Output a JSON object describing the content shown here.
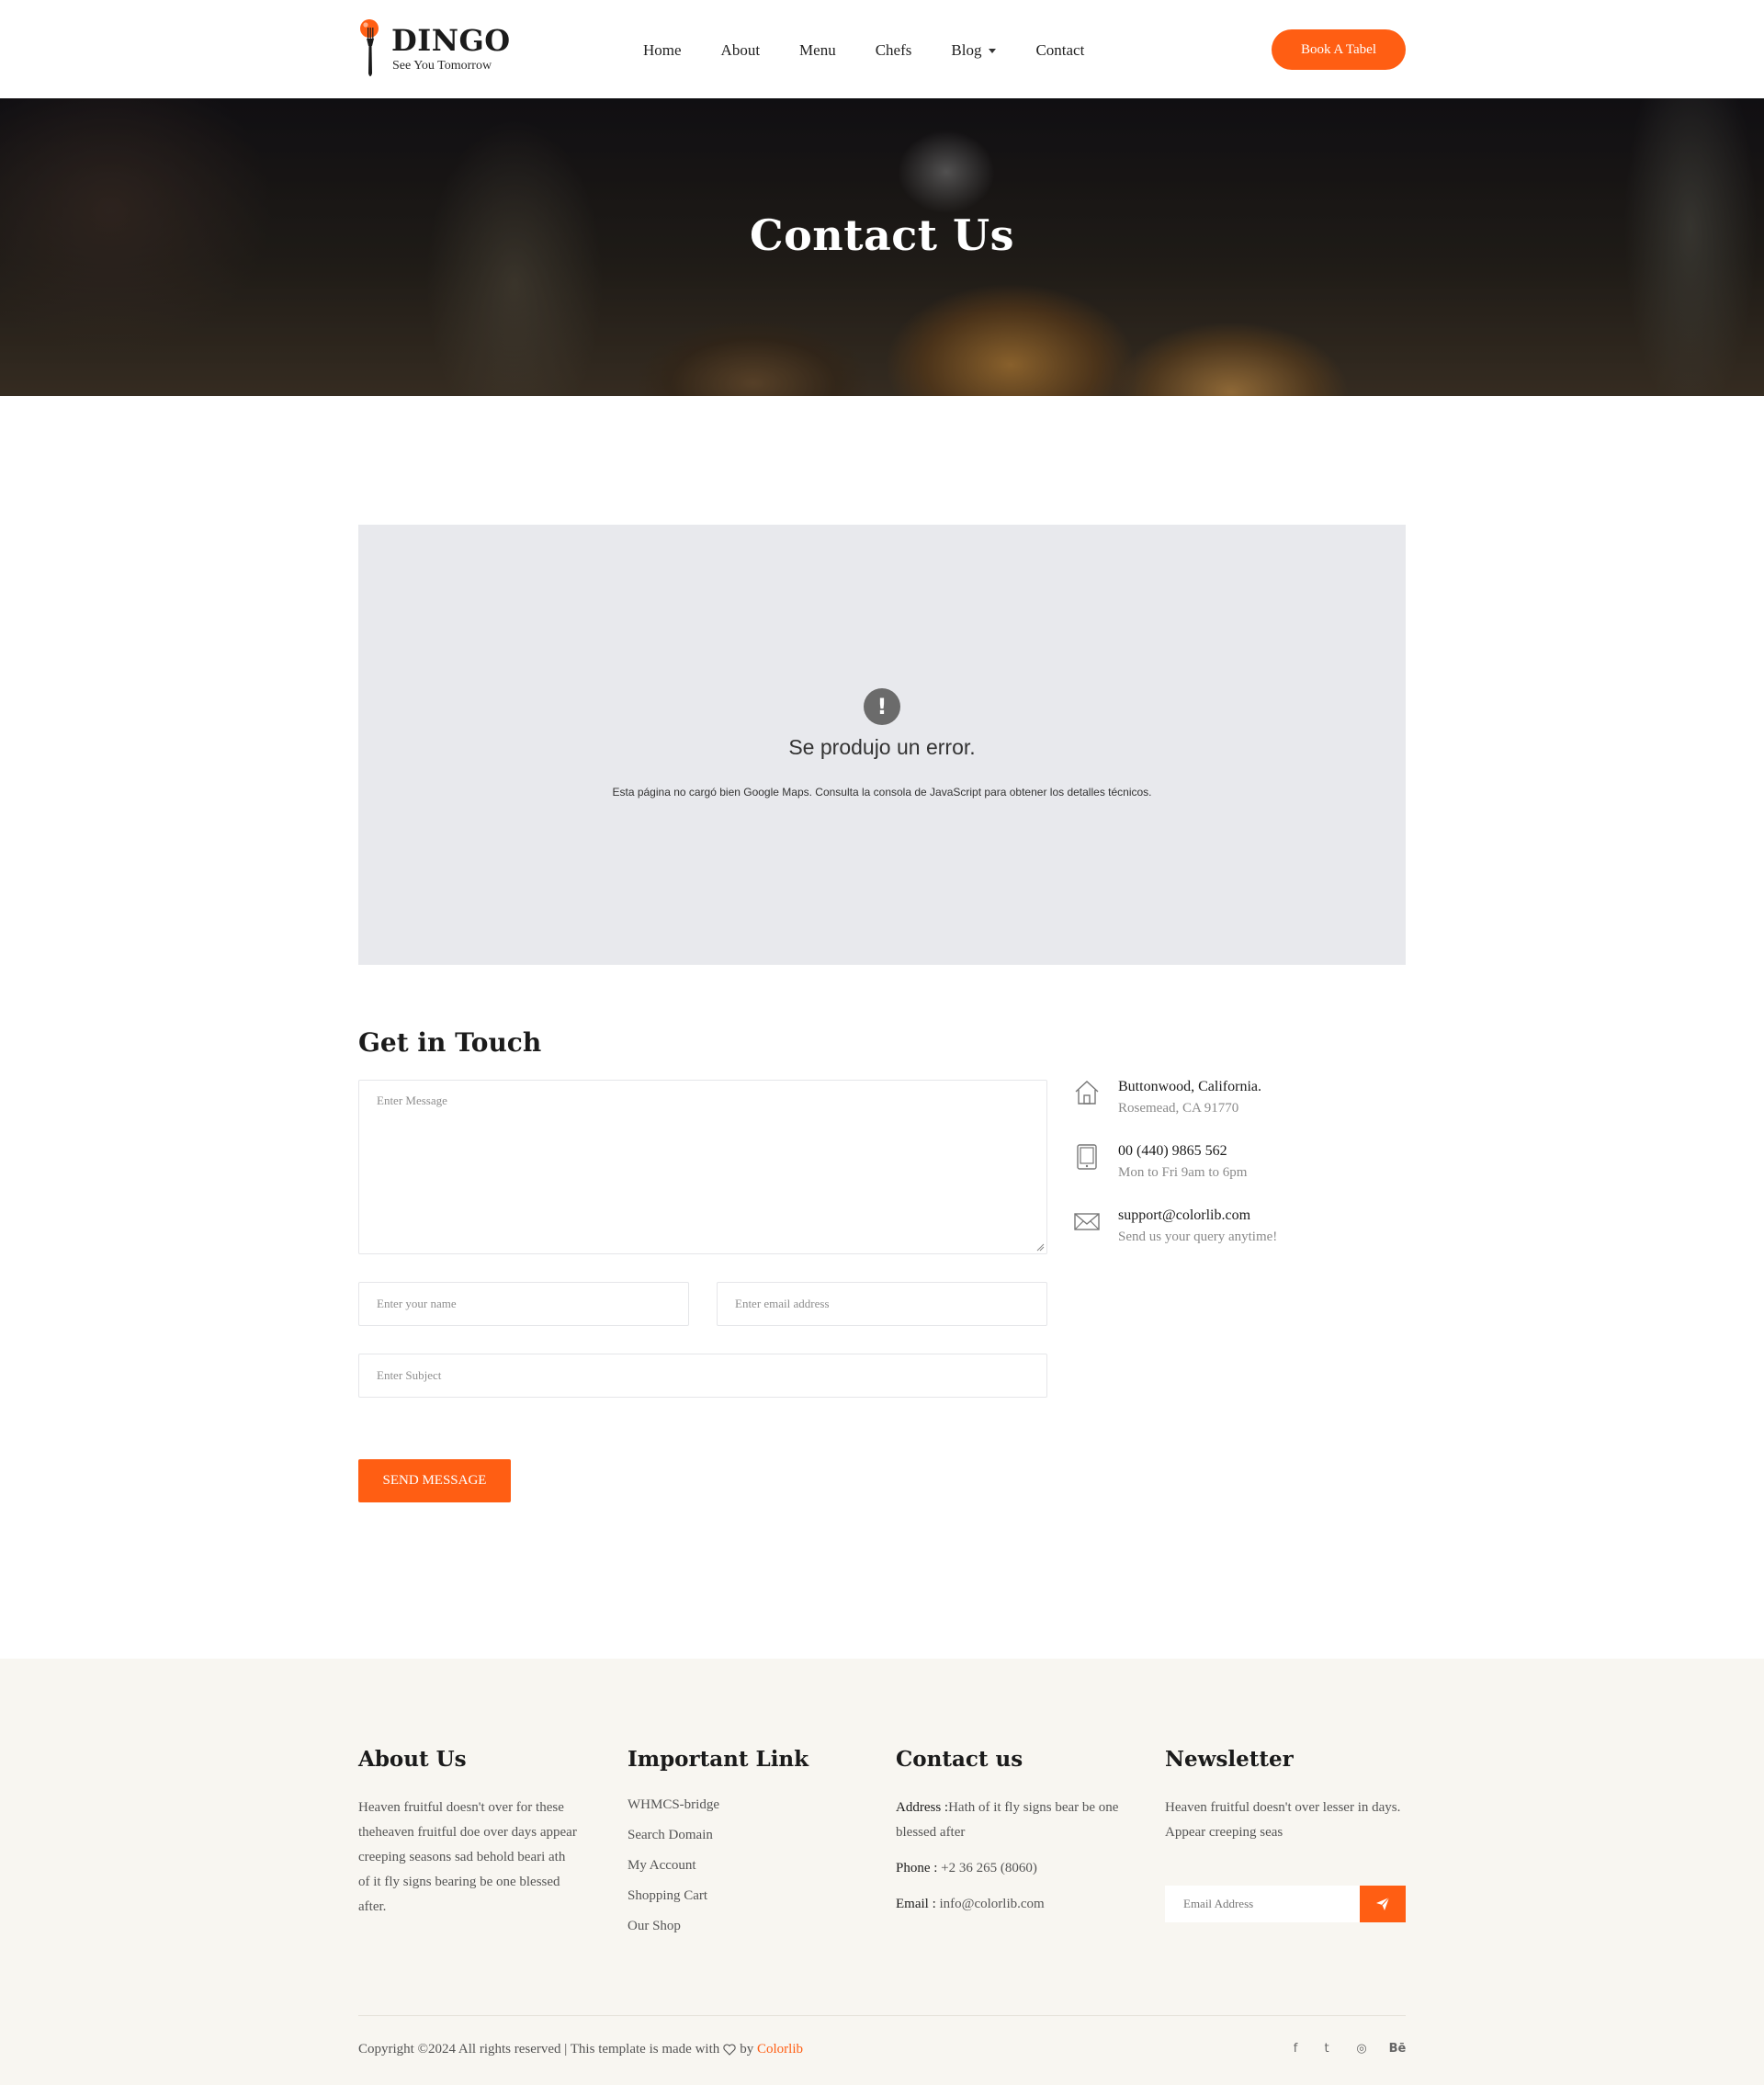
{
  "header": {
    "logo_title": "DINGO",
    "logo_tagline": "See You Tomorrow",
    "nav": [
      {
        "label": "Home"
      },
      {
        "label": "About"
      },
      {
        "label": "Menu"
      },
      {
        "label": "Chefs"
      },
      {
        "label": "Blog",
        "has_dropdown": true
      },
      {
        "label": "Contact"
      }
    ],
    "cta_label": "Book A Tabel"
  },
  "banner": {
    "title": "Contact Us"
  },
  "map": {
    "error_title": "Se produjo un error.",
    "error_text": "Esta página no cargó bien Google Maps. Consulta la consola de JavaScript para obtener los detalles técnicos."
  },
  "contact": {
    "title": "Get in Touch",
    "message_placeholder": "Enter Message",
    "name_placeholder": "Enter your name",
    "email_placeholder": "Enter email address",
    "subject_placeholder": "Enter Subject",
    "send_label": "SEND MESSAGE",
    "info": [
      {
        "icon": "home-icon",
        "main": "Buttonwood, California.",
        "sub": "Rosemead, CA 91770"
      },
      {
        "icon": "tablet-icon",
        "main": "00 (440) 9865 562",
        "sub": "Mon to Fri 9am to 6pm"
      },
      {
        "icon": "email-icon",
        "main": "support@colorlib.com",
        "sub": "Send us your query anytime!"
      }
    ]
  },
  "footer": {
    "about": {
      "title": "About Us",
      "text": "Heaven fruitful doesn't over for these theheaven fruitful doe over days appear creeping seasons sad behold beari ath of it fly signs bearing be one blessed after."
    },
    "links": {
      "title": "Important Link",
      "items": [
        "WHMCS-bridge",
        "Search Domain",
        "My Account",
        "Shopping Cart",
        "Our Shop"
      ]
    },
    "contact": {
      "title": "Contact us",
      "address_label": "Address :",
      "address_value": "Hath of it fly signs bear be one blessed after",
      "phone_label": "Phone :",
      "phone_value": " +2 36 265 (8060)",
      "email_label": "Email :",
      "email_value": " info@colorlib.com"
    },
    "newsletter": {
      "title": "Newsletter",
      "text": "Heaven fruitful doesn't over lesser in days. Appear creeping seas",
      "input_placeholder": "Email Address"
    },
    "copyright_prefix": "Copyright ©2024 All rights reserved | This template is made with",
    "copyright_by": "by",
    "copyright_brand": "Colorlib",
    "social": [
      {
        "icon": "facebook-icon",
        "glyph": "f"
      },
      {
        "icon": "twitter-icon",
        "glyph": "t"
      },
      {
        "icon": "dribbble-icon",
        "glyph": "◎"
      },
      {
        "icon": "behance-icon",
        "glyph": "Bē"
      }
    ]
  },
  "colors": {
    "accent": "#ff5e13",
    "map_bg": "#e8e9ed",
    "footer_bg": "#f8f6f1"
  }
}
